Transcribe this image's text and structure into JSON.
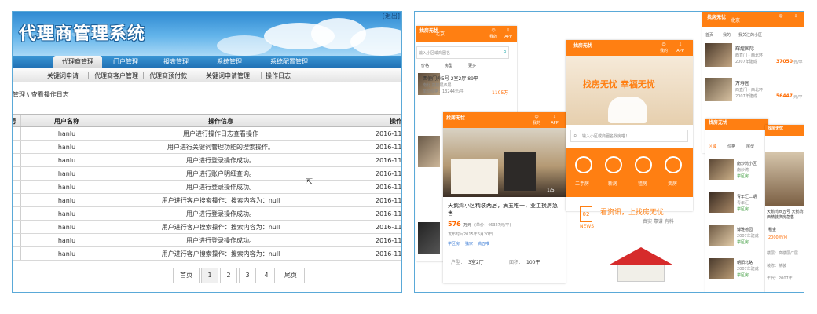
{
  "admin": {
    "title": "代理商管理系统",
    "logout": "[退出]",
    "nav": [
      "代理商管理",
      "门户管理",
      "报表管理",
      "系统管理",
      "系统配置管理"
    ],
    "subnav": [
      "关键词申请",
      "代理商客户管理",
      "代理商预付款",
      "关键词申请管理",
      "操作日志"
    ],
    "breadcrumb": "管理 \\ 查看操作日志",
    "columns": [
      "号",
      "用户名称",
      "操作信息",
      "操作"
    ],
    "rows": [
      {
        "user": "hanlu",
        "info": "用户进行操作日志查看操作",
        "time": "2016-11-"
      },
      {
        "user": "hanlu",
        "info": "用户进行关键词管理功能的搜索操作。",
        "time": "2016-11-"
      },
      {
        "user": "hanlu",
        "info": "用户进行登录操作成功。",
        "time": "2016-11-"
      },
      {
        "user": "hanlu",
        "info": "用户进行账户明细查询。",
        "time": "2016-11-"
      },
      {
        "user": "hanlu",
        "info": "用户进行登录操作成功。",
        "time": "2016-11-"
      },
      {
        "user": "hanlu",
        "info": "用户进行客户搜索操作：搜索内容为：null",
        "time": "2016-11-"
      },
      {
        "user": "hanlu",
        "info": "用户进行登录操作成功。",
        "time": "2016-11-"
      },
      {
        "user": "hanlu",
        "info": "用户进行客户搜索操作：搜索内容为：null",
        "time": "2016-11-"
      },
      {
        "user": "hanlu",
        "info": "用户进行登录操作成功。",
        "time": "2016-11-"
      },
      {
        "user": "hanlu",
        "info": "用户进行客户搜索操作：搜索内容为：null",
        "time": "2016-11-"
      }
    ],
    "pager": [
      "首页",
      "1",
      "2",
      "3",
      "4",
      "尾页"
    ]
  },
  "mobile": {
    "brand": "找房无忧",
    "city": "北京",
    "my": "我的",
    "app": "APP",
    "search_placeholder": "输入小区或商圈名",
    "search_placeholder_2": "输入小区或商圈名找房喵！",
    "filters": [
      "价格",
      "房型",
      "更多"
    ],
    "listing1": {
      "title": "西便门外5号 2室2厅 89平",
      "sub": "南北 高楼层/6层",
      "price": "1105万",
      "unit": "单价价格：13244元/平"
    },
    "featured": {
      "title": "天鹅湾小区精装两居，满五唯一，业主换房急售",
      "price": "576",
      "price_unit": "万元",
      "unit_price": "(单价：46327元/平)",
      "date": "发布时间2015年6月20日",
      "tags": [
        "学区房",
        "独家",
        "满五唯一"
      ],
      "rooms_label": "户型：",
      "rooms": "3室2厅",
      "area_label": "面积：",
      "area": "100平",
      "counter": "1/5"
    },
    "slogan": "找房无忧 幸福无忧",
    "categories": [
      "二手房",
      "新房",
      "租房",
      "卖房"
    ],
    "news_slogan": "看资讯，上找房无忧",
    "news_sub": "真实 靠谱 有料",
    "news_tag": "NEWS",
    "right_nav": [
      "首页",
      "我的",
      "我关注的小区"
    ],
    "right_filters": [
      "区域",
      "价格",
      "房型"
    ],
    "right_list": [
      {
        "name": "辉煌国际",
        "sub": "西直门 - 西北环",
        "year": "2007年建成",
        "price": "37050",
        "unit": "元/平"
      },
      {
        "name": "万寿园",
        "sub": "西直门 - 西北环",
        "year": "2007年建成",
        "price": "56447",
        "unit": "元/平"
      },
      {
        "name": "南沙湾小区",
        "sub": "南沙湾",
        "tag": "学区房"
      },
      {
        "name": "青年汇二期",
        "sub": "青年汇",
        "tag": "学区房"
      },
      {
        "name": "博雅德园",
        "sub": "2007年建成",
        "tag": "学区房"
      },
      {
        "name": "朝阳北路",
        "sub": "2007年建成",
        "tag": "学区房"
      }
    ],
    "detail": {
      "title": "天鹅湾西五号 天鹅湾西精装换房急售",
      "price_label": "租金",
      "price": "2000元/月",
      "floor": "楼层：高楼层/7层",
      "deco": "装修：精装",
      "year": "年代：2007年"
    }
  }
}
